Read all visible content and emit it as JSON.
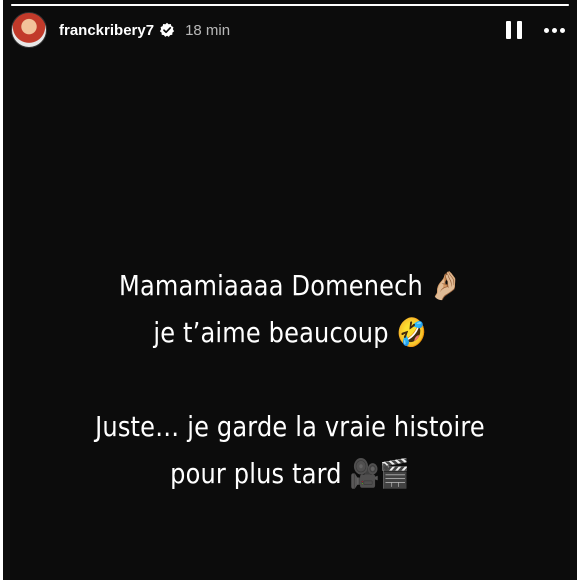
{
  "story": {
    "progress_fraction": 1.0,
    "username": "franckribery7",
    "time_ago": "18 min",
    "caption": {
      "line1": "Mamamiaaaa Domenech 🤌🏼",
      "line2": "je t’aime beaucoup 🤣",
      "line3": "Juste… je garde la vraie histoire",
      "line4": "pour plus tard 🎥🎬"
    }
  },
  "icons": {
    "verified": "verified-badge-icon",
    "pause": "pause-icon",
    "more": "more-options-icon"
  }
}
